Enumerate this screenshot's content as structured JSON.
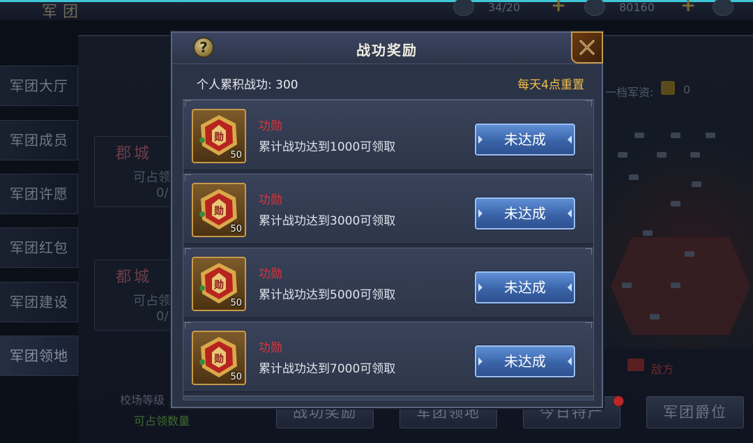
{
  "background": {
    "title": "军团",
    "resources": [
      {
        "icon": "leaf-resource-icon",
        "value": "34/20"
      },
      {
        "icon": "coin-resource-icon",
        "value": "80160"
      }
    ],
    "sidebar": [
      {
        "label": "军团大厅"
      },
      {
        "label": "军团成员"
      },
      {
        "label": "军团许愿"
      },
      {
        "label": "军团红包"
      },
      {
        "label": "军团建设"
      },
      {
        "label": "军团领地"
      }
    ],
    "cities": [
      {
        "name": "郡城",
        "line1": "可占领",
        "line2": "0/"
      },
      {
        "name": "都城",
        "line1": "可占领",
        "line2": "0/"
      }
    ],
    "school_level": "校场等级",
    "occupy_count": "可占领数量",
    "supply_label": "一档军资:",
    "supply_value": "0",
    "enemy_label": "敌方",
    "bottom_tabs": [
      "战功奖励",
      "军团领地",
      "今日特产",
      "军团爵位"
    ]
  },
  "modal": {
    "title": "战功奖励",
    "help_label": "?",
    "merit_total": "个人累积战功: 300",
    "reset_note": "每天4点重置",
    "rewards": [
      {
        "name": "功勋",
        "count": "50",
        "desc": "累计战功达到1000可领取",
        "button": "未达成"
      },
      {
        "name": "功勋",
        "count": "50",
        "desc": "累计战功达到3000可领取",
        "button": "未达成"
      },
      {
        "name": "功勋",
        "count": "50",
        "desc": "累计战功达到5000可领取",
        "button": "未达成"
      },
      {
        "name": "功勋",
        "count": "50",
        "desc": "累计战功达到7000可领取",
        "button": "未达成"
      }
    ]
  },
  "colors": {
    "reward_name": "#e1333a",
    "reset_note": "#f2c04c",
    "button": "#3a64a8"
  }
}
